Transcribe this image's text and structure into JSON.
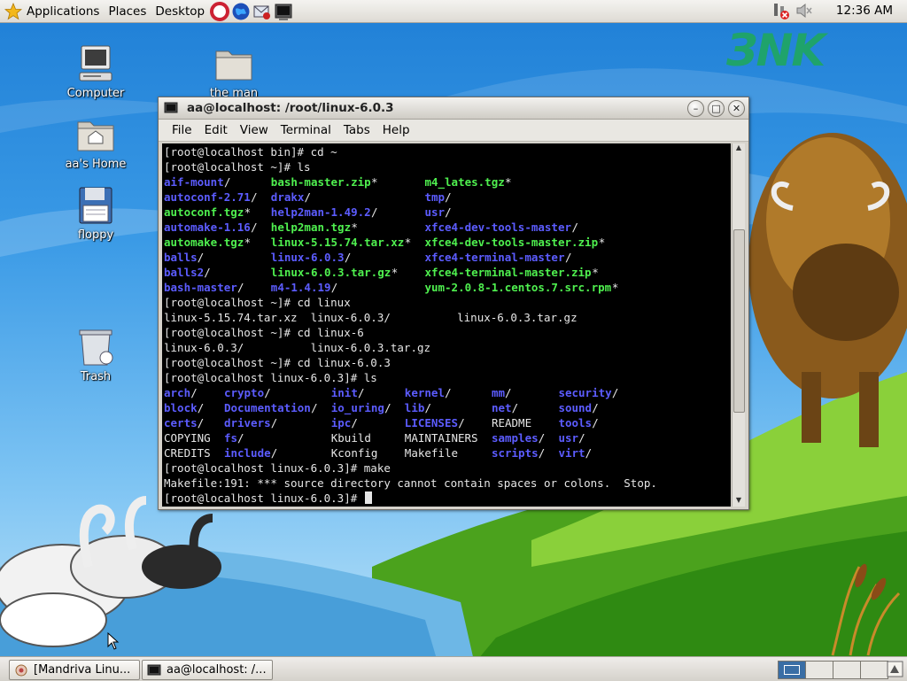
{
  "top_panel": {
    "menus": [
      "Applications",
      "Places",
      "Desktop"
    ],
    "launchers": [
      "help-icon",
      "web-browser-icon",
      "email-icon",
      "terminal-icon"
    ],
    "tray": [
      "network-disconnected-icon",
      "volume-muted-icon"
    ],
    "clock": "12:36 AM"
  },
  "desktop": {
    "icons": [
      {
        "label": "Computer",
        "icon": "computer-icon"
      },
      {
        "label": "the man",
        "icon": "folder-icon"
      },
      {
        "label": "aa's Home",
        "icon": "home-folder-icon"
      },
      {
        "label": "floppy",
        "icon": "floppy-icon"
      },
      {
        "label": "Trash",
        "icon": "trash-icon"
      }
    ],
    "wallpaper_logo": "ЗNK"
  },
  "terminal_window": {
    "title": "aa@localhost: /root/linux-6.0.3",
    "menu": [
      "File",
      "Edit",
      "View",
      "Terminal",
      "Tabs",
      "Help"
    ],
    "lines": [
      [
        {
          "t": "[root@localhost bin]# cd ~",
          "c": "plain",
          "x": 0
        }
      ],
      [
        {
          "t": "[root@localhost ~]# ls",
          "c": "plain",
          "x": 0
        }
      ],
      [
        {
          "t": "aif-mount",
          "c": "dir",
          "x": 0
        },
        {
          "t": "/",
          "c": "plain",
          "x": 9
        },
        {
          "t": "bash-master.zip",
          "c": "exe",
          "x": 16
        },
        {
          "t": "*",
          "c": "plain",
          "x": 31
        },
        {
          "t": "m4_lates.tgz",
          "c": "exe",
          "x": 39
        },
        {
          "t": "*",
          "c": "plain",
          "x": 51
        }
      ],
      [
        {
          "t": "autoconf-2.71",
          "c": "dir",
          "x": 0
        },
        {
          "t": "/",
          "c": "plain",
          "x": 13
        },
        {
          "t": "drakx",
          "c": "dir",
          "x": 16
        },
        {
          "t": "/",
          "c": "plain",
          "x": 21
        },
        {
          "t": "tmp",
          "c": "dir",
          "x": 39
        },
        {
          "t": "/",
          "c": "plain",
          "x": 42
        }
      ],
      [
        {
          "t": "autoconf.tgz",
          "c": "exe",
          "x": 0
        },
        {
          "t": "*",
          "c": "plain",
          "x": 12
        },
        {
          "t": "help2man-1.49.2",
          "c": "dir",
          "x": 16
        },
        {
          "t": "/",
          "c": "plain",
          "x": 31
        },
        {
          "t": "usr",
          "c": "dir",
          "x": 39
        },
        {
          "t": "/",
          "c": "plain",
          "x": 42
        }
      ],
      [
        {
          "t": "automake-1.16",
          "c": "dir",
          "x": 0
        },
        {
          "t": "/",
          "c": "plain",
          "x": 13
        },
        {
          "t": "help2man.tgz",
          "c": "exe",
          "x": 16
        },
        {
          "t": "*",
          "c": "plain",
          "x": 28
        },
        {
          "t": "xfce4-dev-tools-master",
          "c": "dir",
          "x": 39
        },
        {
          "t": "/",
          "c": "plain",
          "x": 61
        }
      ],
      [
        {
          "t": "automake.tgz",
          "c": "exe",
          "x": 0
        },
        {
          "t": "*",
          "c": "plain",
          "x": 12
        },
        {
          "t": "linux-5.15.74.tar.xz",
          "c": "exe",
          "x": 16
        },
        {
          "t": "*",
          "c": "plain",
          "x": 36
        },
        {
          "t": "xfce4-dev-tools-master.zip",
          "c": "exe",
          "x": 39
        },
        {
          "t": "*",
          "c": "plain",
          "x": 65
        }
      ],
      [
        {
          "t": "balls",
          "c": "dir",
          "x": 0
        },
        {
          "t": "/",
          "c": "plain",
          "x": 5
        },
        {
          "t": "linux-6.0.3",
          "c": "dir",
          "x": 16
        },
        {
          "t": "/",
          "c": "plain",
          "x": 27
        },
        {
          "t": "xfce4-terminal-master",
          "c": "dir",
          "x": 39
        },
        {
          "t": "/",
          "c": "plain",
          "x": 60
        }
      ],
      [
        {
          "t": "balls2",
          "c": "dir",
          "x": 0
        },
        {
          "t": "/",
          "c": "plain",
          "x": 6
        },
        {
          "t": "linux-6.0.3.tar.gz",
          "c": "exe",
          "x": 16
        },
        {
          "t": "*",
          "c": "plain",
          "x": 34
        },
        {
          "t": "xfce4-terminal-master.zip",
          "c": "exe",
          "x": 39
        },
        {
          "t": "*",
          "c": "plain",
          "x": 64
        }
      ],
      [
        {
          "t": "bash-master",
          "c": "dir",
          "x": 0
        },
        {
          "t": "/",
          "c": "plain",
          "x": 11
        },
        {
          "t": "m4-1.4.19",
          "c": "dir",
          "x": 16
        },
        {
          "t": "/",
          "c": "plain",
          "x": 25
        },
        {
          "t": "yum-2.0.8-1.centos.7.src.rpm",
          "c": "exe",
          "x": 39
        },
        {
          "t": "*",
          "c": "plain",
          "x": 67
        }
      ],
      [
        {
          "t": "[root@localhost ~]# cd linux",
          "c": "plain",
          "x": 0
        }
      ],
      [
        {
          "t": "linux-5.15.74.tar.xz  linux-6.0.3/          linux-6.0.3.tar.gz",
          "c": "plain",
          "x": 0
        }
      ],
      [
        {
          "t": "[root@localhost ~]# cd linux-6",
          "c": "plain",
          "x": 0
        }
      ],
      [
        {
          "t": "linux-6.0.3/          linux-6.0.3.tar.gz",
          "c": "plain",
          "x": 0
        }
      ],
      [
        {
          "t": "[root@localhost ~]# cd linux-6.0.3",
          "c": "plain",
          "x": 0
        }
      ],
      [
        {
          "t": "[root@localhost linux-6.0.3]# ls",
          "c": "plain",
          "x": 0
        }
      ],
      [
        {
          "t": "arch",
          "c": "dir",
          "x": 0
        },
        {
          "t": "/",
          "c": "plain",
          "x": 4
        },
        {
          "t": "crypto",
          "c": "dir",
          "x": 9
        },
        {
          "t": "/",
          "c": "plain",
          "x": 15
        },
        {
          "t": "init",
          "c": "dir",
          "x": 25
        },
        {
          "t": "/",
          "c": "plain",
          "x": 29
        },
        {
          "t": "kernel",
          "c": "dir",
          "x": 36
        },
        {
          "t": "/",
          "c": "plain",
          "x": 42
        },
        {
          "t": "mm",
          "c": "dir",
          "x": 49
        },
        {
          "t": "/",
          "c": "plain",
          "x": 51
        },
        {
          "t": "security",
          "c": "dir",
          "x": 59
        },
        {
          "t": "/",
          "c": "plain",
          "x": 67
        }
      ],
      [
        {
          "t": "block",
          "c": "dir",
          "x": 0
        },
        {
          "t": "/",
          "c": "plain",
          "x": 5
        },
        {
          "t": "Documentation",
          "c": "dir",
          "x": 9
        },
        {
          "t": "/",
          "c": "plain",
          "x": 22
        },
        {
          "t": "io_uring",
          "c": "dir",
          "x": 25
        },
        {
          "t": "/",
          "c": "plain",
          "x": 33
        },
        {
          "t": "lib",
          "c": "dir",
          "x": 36
        },
        {
          "t": "/",
          "c": "plain",
          "x": 39
        },
        {
          "t": "net",
          "c": "dir",
          "x": 49
        },
        {
          "t": "/",
          "c": "plain",
          "x": 52
        },
        {
          "t": "sound",
          "c": "dir",
          "x": 59
        },
        {
          "t": "/",
          "c": "plain",
          "x": 64
        }
      ],
      [
        {
          "t": "certs",
          "c": "dir",
          "x": 0
        },
        {
          "t": "/",
          "c": "plain",
          "x": 5
        },
        {
          "t": "drivers",
          "c": "dir",
          "x": 9
        },
        {
          "t": "/",
          "c": "plain",
          "x": 16
        },
        {
          "t": "ipc",
          "c": "dir",
          "x": 25
        },
        {
          "t": "/",
          "c": "plain",
          "x": 28
        },
        {
          "t": "LICENSES",
          "c": "dir",
          "x": 36
        },
        {
          "t": "/",
          "c": "plain",
          "x": 44
        },
        {
          "t": "README",
          "c": "plain",
          "x": 49
        },
        {
          "t": "tools",
          "c": "dir",
          "x": 59
        },
        {
          "t": "/",
          "c": "plain",
          "x": 64
        }
      ],
      [
        {
          "t": "COPYING",
          "c": "plain",
          "x": 0
        },
        {
          "t": "fs",
          "c": "dir",
          "x": 9
        },
        {
          "t": "/",
          "c": "plain",
          "x": 11
        },
        {
          "t": "Kbuild",
          "c": "plain",
          "x": 25
        },
        {
          "t": "MAINTAINERS",
          "c": "plain",
          "x": 36
        },
        {
          "t": "samples",
          "c": "dir",
          "x": 49
        },
        {
          "t": "/",
          "c": "plain",
          "x": 56
        },
        {
          "t": "usr",
          "c": "dir",
          "x": 59
        },
        {
          "t": "/",
          "c": "plain",
          "x": 62
        }
      ],
      [
        {
          "t": "CREDITS",
          "c": "plain",
          "x": 0
        },
        {
          "t": "include",
          "c": "dir",
          "x": 9
        },
        {
          "t": "/",
          "c": "plain",
          "x": 16
        },
        {
          "t": "Kconfig",
          "c": "plain",
          "x": 25
        },
        {
          "t": "Makefile",
          "c": "plain",
          "x": 36
        },
        {
          "t": "scripts",
          "c": "dir",
          "x": 49
        },
        {
          "t": "/",
          "c": "plain",
          "x": 56
        },
        {
          "t": "virt",
          "c": "dir",
          "x": 59
        },
        {
          "t": "/",
          "c": "plain",
          "x": 63
        }
      ],
      [
        {
          "t": "[root@localhost linux-6.0.3]# make",
          "c": "plain",
          "x": 0
        }
      ],
      [
        {
          "t": "Makefile:191: *** source directory cannot contain spaces or colons.  Stop.",
          "c": "plain",
          "x": 0
        }
      ],
      [
        {
          "t": "[root@localhost linux-6.0.3]# ",
          "c": "plain",
          "x": 0
        }
      ]
    ],
    "scroll_position": 0.47
  },
  "bottom_panel": {
    "tasks": [
      {
        "label": "[Mandriva Linu...",
        "icon": "mandriva-icon"
      },
      {
        "label": "aa@localhost: /...",
        "icon": "terminal-icon"
      }
    ],
    "workspaces": 4,
    "active_workspace": 1
  },
  "colors": {
    "dir": "#5c5cff",
    "exe": "#4ff04f",
    "plain": "#e6e6e6",
    "accent": "#2a6fd0"
  }
}
